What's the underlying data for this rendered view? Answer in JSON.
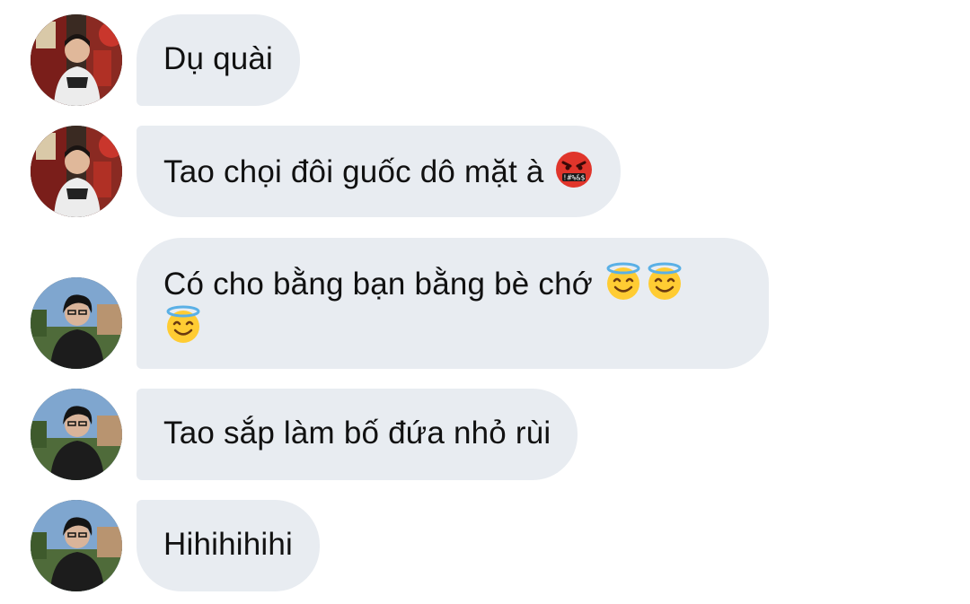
{
  "conversation": {
    "messages": [
      {
        "sender": "contact-a",
        "text": "Dụ quài",
        "emojis": []
      },
      {
        "sender": "contact-a",
        "text": "Tao chọi đôi guốc dô mặt à",
        "emojis": [
          "cursing-face-emoji"
        ]
      },
      {
        "sender": "contact-b",
        "text": "Có cho bằng bạn bằng bè chớ",
        "emojis": [
          "smiling-face-with-halo-emoji",
          "smiling-face-with-halo-emoji",
          "smiling-face-with-halo-emoji"
        ]
      },
      {
        "sender": "contact-b",
        "text": "Tao sắp làm bố đứa nhỏ rùi",
        "emojis": []
      },
      {
        "sender": "contact-b",
        "text": "Hihihihihi",
        "emojis": []
      }
    ]
  },
  "colors": {
    "bubble_background": "#e8ecf1",
    "text": "#111111",
    "page_background": "#ffffff"
  }
}
